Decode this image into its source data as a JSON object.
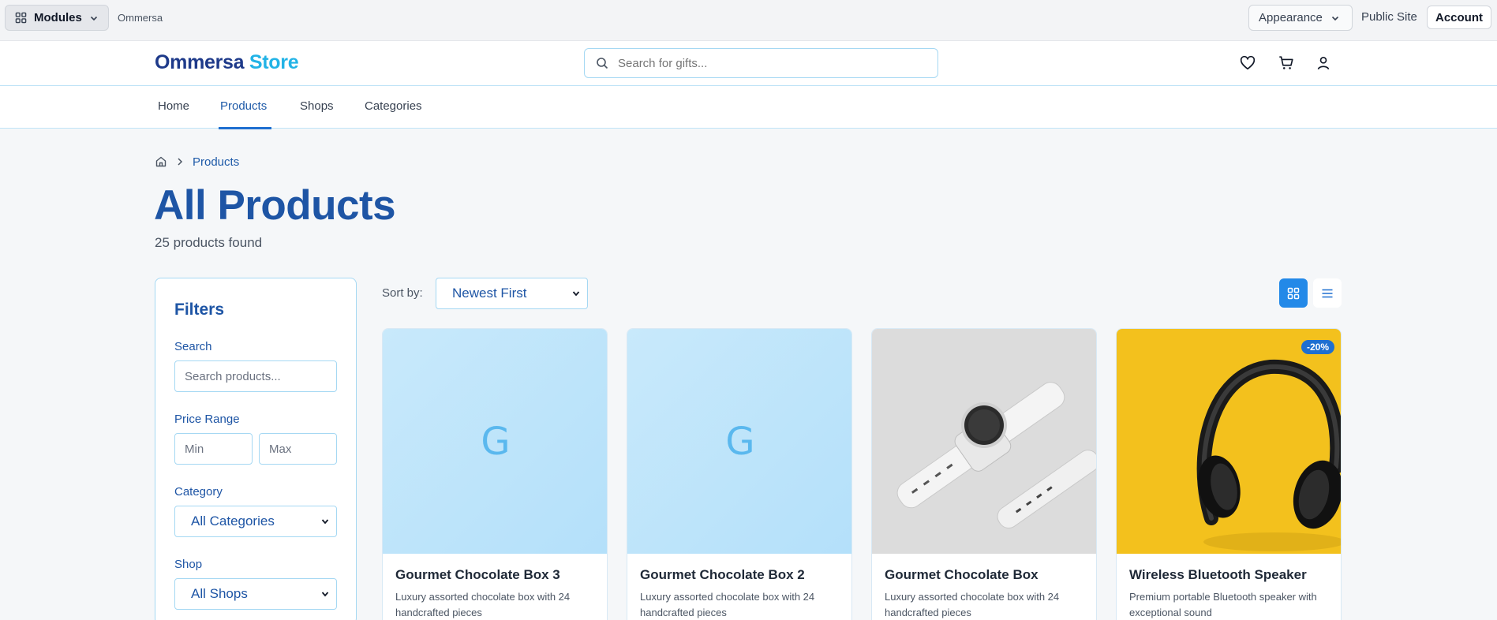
{
  "adminbar": {
    "modules_label": "Modules",
    "brand": "Ommersa",
    "appearance_label": "Appearance",
    "public_site_label": "Public Site",
    "account_label": "Account"
  },
  "header": {
    "logo_primary": "Ommersa",
    "logo_secondary": "Store",
    "search_placeholder": "Search for gifts..."
  },
  "nav": {
    "items": [
      {
        "label": "Home"
      },
      {
        "label": "Products"
      },
      {
        "label": "Shops"
      },
      {
        "label": "Categories"
      }
    ],
    "active": "Products"
  },
  "breadcrumb": {
    "current": "Products"
  },
  "page": {
    "title": "All Products",
    "count_text": "25 products found"
  },
  "filters": {
    "title": "Filters",
    "search_label": "Search",
    "search_placeholder": "Search products...",
    "price_label": "Price Range",
    "min_placeholder": "Min",
    "max_placeholder": "Max",
    "category_label": "Category",
    "category_value": "All Categories",
    "shop_label": "Shop",
    "shop_value": "All Shops"
  },
  "sort": {
    "label": "Sort by:",
    "value": "Newest First"
  },
  "products": [
    {
      "name": "Gourmet Chocolate Box 3",
      "desc": "Luxury assorted chocolate box with 24 handcrafted pieces",
      "placeholder_letter": "G"
    },
    {
      "name": "Gourmet Chocolate Box 2",
      "desc": "Luxury assorted chocolate box with 24 handcrafted pieces",
      "placeholder_letter": "G"
    },
    {
      "name": "Gourmet Chocolate Box",
      "desc": "Luxury assorted chocolate box with 24 handcrafted pieces",
      "image": "white-smartwatch"
    },
    {
      "name": "Wireless Bluetooth Speaker",
      "desc": "Premium portable Bluetooth speaker with exceptional sound",
      "image": "black-headphones-on-yellow",
      "badge": "-20%"
    }
  ],
  "colors": {
    "primary": "#1e55a5",
    "accent": "#22b3e6",
    "button_active": "#2389e8",
    "border": "#a5d8f3"
  }
}
